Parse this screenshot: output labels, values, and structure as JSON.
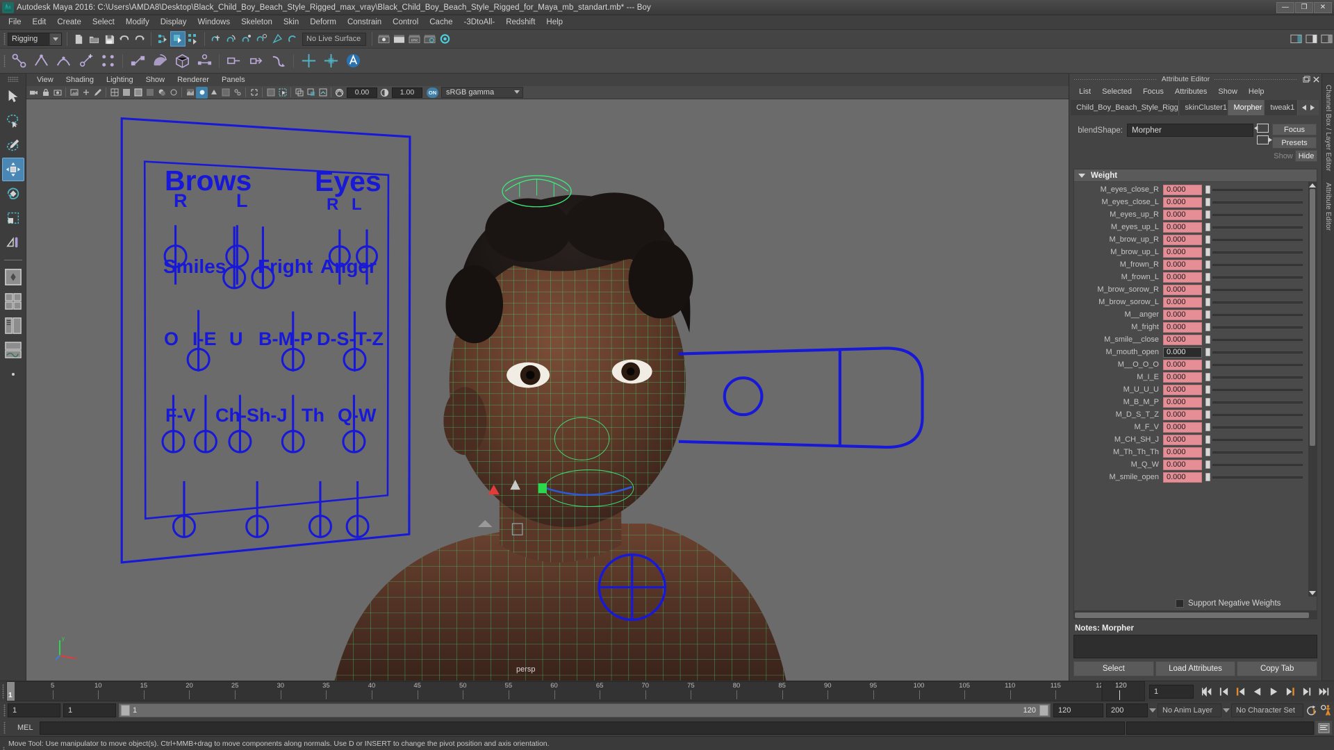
{
  "titlebar": {
    "title": "Autodesk Maya 2016: C:\\Users\\AMDA8\\Desktop\\Black_Child_Boy_Beach_Style_Rigged_max_vray\\Black_Child_Boy_Beach_Style_Rigged_for_Maya_mb_standart.mb*  ---  Boy",
    "minimize": "—",
    "maximize": "❐",
    "close": "✕"
  },
  "menubar": {
    "items": [
      "File",
      "Edit",
      "Create",
      "Select",
      "Modify",
      "Display",
      "Windows",
      "Skeleton",
      "Skin",
      "Deform",
      "Constrain",
      "Control",
      "Cache",
      "-3DtoAll-",
      "Redshift",
      "Help"
    ]
  },
  "toolbar": {
    "mode": "Rigging",
    "live_surface": "No Live Surface"
  },
  "viewport_panel_menu": {
    "items": [
      "View",
      "Shading",
      "Lighting",
      "Show",
      "Renderer",
      "Panels"
    ]
  },
  "viewport_toolbar": {
    "exposure": "0.00",
    "gamma": "1.00",
    "toggle": "ON",
    "color_space": "sRGB gamma"
  },
  "viewport": {
    "camera_label": "persp",
    "rig_color": "#1818d8",
    "wireframe_color": "#3ee87a",
    "background_color": "#6b6b6b",
    "control_groups": [
      {
        "title": "Brows",
        "sub": [
          "R",
          "L"
        ]
      },
      {
        "title": "Eyes",
        "sub": [
          "R",
          "L"
        ]
      }
    ],
    "control_labels_row2": [
      "Smiles",
      "Fright",
      "Anger"
    ],
    "control_labels_row3": [
      "O",
      "I-E",
      "U",
      "B-M-P",
      "D-S-T-Z"
    ],
    "control_labels_row4": [
      "F-V",
      "Ch-Sh-J",
      "Th",
      "Q-W"
    ]
  },
  "attribute_editor": {
    "panel_title": "Attribute Editor",
    "menu": [
      "List",
      "Selected",
      "Focus",
      "Attributes",
      "Show",
      "Help"
    ],
    "tabs": [
      {
        "label": "Child_Boy_Beach_Style_Rigged",
        "active": false
      },
      {
        "label": "skinCluster1",
        "active": false
      },
      {
        "label": "Morpher",
        "active": true
      },
      {
        "label": "tweak1",
        "active": false
      }
    ],
    "blendshape_label": "blendShape:",
    "blendshape_value": "Morpher",
    "focus_button": "Focus",
    "presets_button": "Presets",
    "show_button": "Show",
    "hide_button": "Hide",
    "weight_section_title": "Weight",
    "weights": [
      {
        "name": "M_eyes_close_R",
        "value": "0.000",
        "focused": false
      },
      {
        "name": "M_eyes_close_L",
        "value": "0.000",
        "focused": false
      },
      {
        "name": "M_eyes_up_R",
        "value": "0.000",
        "focused": false
      },
      {
        "name": "M_eyes_up_L",
        "value": "0.000",
        "focused": false
      },
      {
        "name": "M_brow_up_R",
        "value": "0.000",
        "focused": false
      },
      {
        "name": "M_brow_up_L",
        "value": "0.000",
        "focused": false
      },
      {
        "name": "M_frown_R",
        "value": "0.000",
        "focused": false
      },
      {
        "name": "M_frown_L",
        "value": "0.000",
        "focused": false
      },
      {
        "name": "M_brow_sorow_R",
        "value": "0.000",
        "focused": false
      },
      {
        "name": "M_brow_sorow_L",
        "value": "0.000",
        "focused": false
      },
      {
        "name": "M__anger",
        "value": "0.000",
        "focused": false
      },
      {
        "name": "M_fright",
        "value": "0.000",
        "focused": false
      },
      {
        "name": "M_smile__close",
        "value": "0.000",
        "focused": false
      },
      {
        "name": "M_mouth_open",
        "value": "0.000",
        "focused": true
      },
      {
        "name": "M__O_O_O",
        "value": "0.000",
        "focused": false
      },
      {
        "name": "M_I_E",
        "value": "0.000",
        "focused": false
      },
      {
        "name": "M_U_U_U",
        "value": "0.000",
        "focused": false
      },
      {
        "name": "M_B_M_P",
        "value": "0.000",
        "focused": false
      },
      {
        "name": "M_D_S_T_Z",
        "value": "0.000",
        "focused": false
      },
      {
        "name": "M_F_V",
        "value": "0.000",
        "focused": false
      },
      {
        "name": "M_CH_SH_J",
        "value": "0.000",
        "focused": false
      },
      {
        "name": "M_Th_Th_Th",
        "value": "0.000",
        "focused": false
      },
      {
        "name": "M_Q_W",
        "value": "0.000",
        "focused": false
      },
      {
        "name": "M_smile_open",
        "value": "0.000",
        "focused": false
      }
    ],
    "support_negative_weights": "Support Negative Weights",
    "notes_label": "Notes:",
    "notes_value": "Morpher",
    "footer_buttons": [
      "Select",
      "Load Attributes",
      "Copy Tab"
    ],
    "value_field_color": "#e58e96"
  },
  "right_vtabs": [
    "Channel Box / Layer Editor",
    "Attribute Editor"
  ],
  "timeline": {
    "ticks": [
      "5",
      "10",
      "15",
      "20",
      "25",
      "30",
      "35",
      "40",
      "45",
      "50",
      "55",
      "60",
      "65",
      "70",
      "75",
      "80",
      "85",
      "90",
      "95",
      "100",
      "105",
      "110",
      "115",
      "120"
    ],
    "current_frame": "1",
    "end_label": "120",
    "current_field": "1"
  },
  "range_slider": {
    "start": "1",
    "anim_start": "1",
    "bar_start_label": "1",
    "bar_end_label": "120",
    "anim_end": "120",
    "end": "200",
    "anim_layer": "No Anim Layer",
    "character_set": "No Character Set"
  },
  "command_line": {
    "label": "MEL",
    "input_value": ""
  },
  "statusbar": {
    "help_text": "Move Tool: Use manipulator to move object(s). Ctrl+MMB+drag to move components along normals. Use D or INSERT to change the pivot position and axis orientation."
  }
}
